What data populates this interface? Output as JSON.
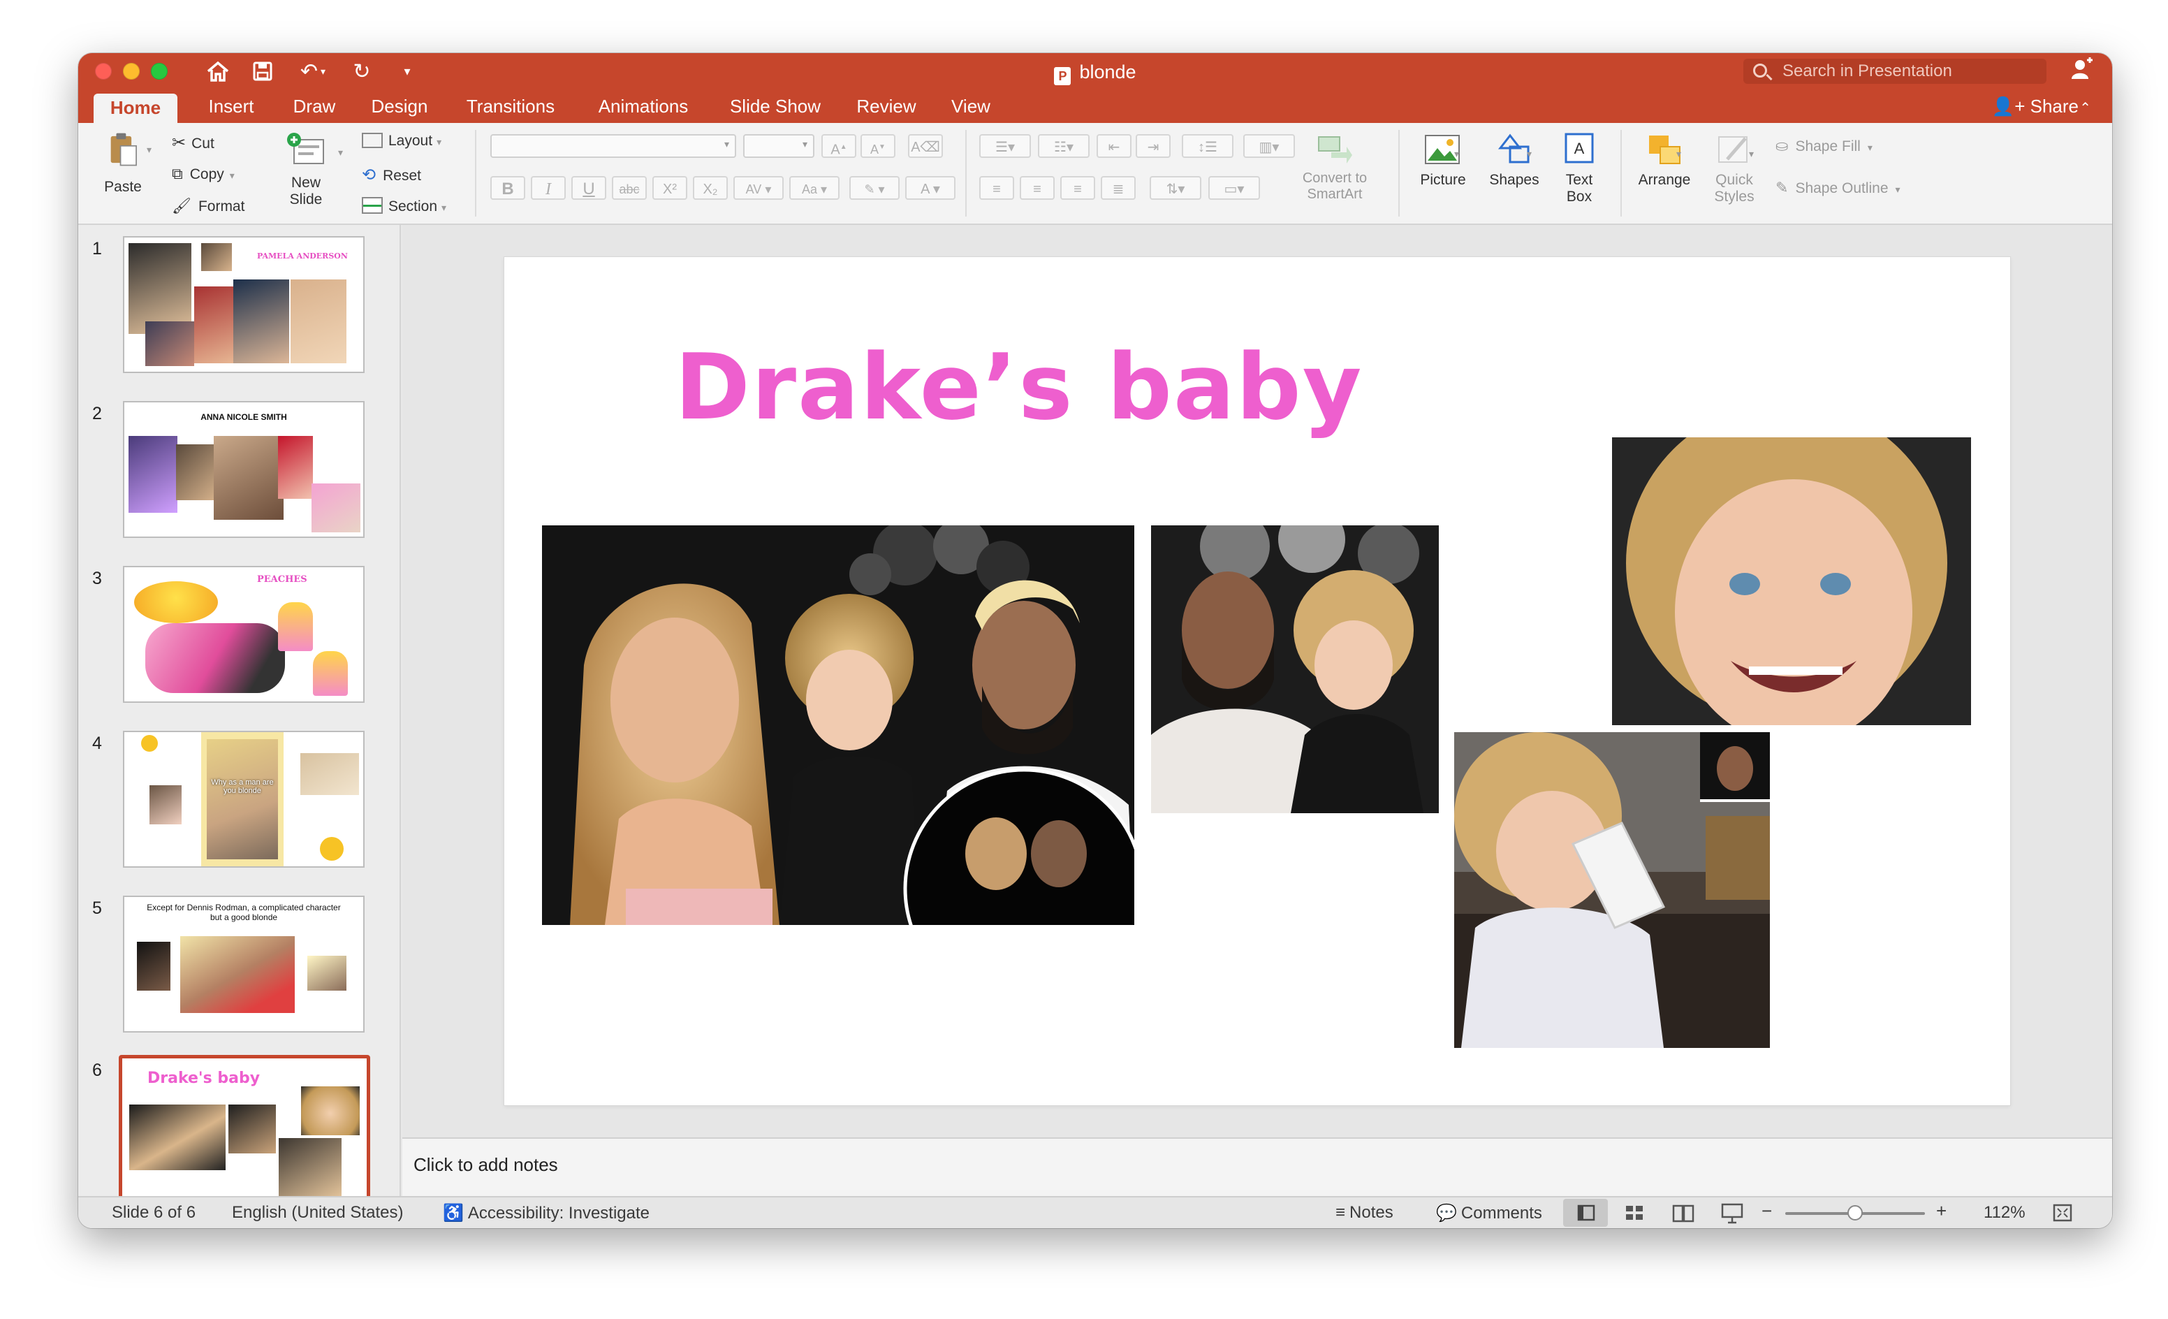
{
  "window": {
    "title": "blonde",
    "search_placeholder": "Search in Presentation"
  },
  "tabs": [
    {
      "label": "Home",
      "active": true
    },
    {
      "label": "Insert"
    },
    {
      "label": "Draw"
    },
    {
      "label": "Design"
    },
    {
      "label": "Transitions"
    },
    {
      "label": "Animations"
    },
    {
      "label": "Slide Show"
    },
    {
      "label": "Review"
    },
    {
      "label": "View"
    }
  ],
  "share_label": "Share",
  "ribbon": {
    "paste": "Paste",
    "cut": "Cut",
    "copy": "Copy",
    "format": "Format",
    "new_slide_line1": "New",
    "new_slide_line2": "Slide",
    "layout": "Layout",
    "reset": "Reset",
    "section": "Section",
    "convert_line1": "Convert to",
    "convert_line2": "SmartArt",
    "picture": "Picture",
    "shapes": "Shapes",
    "textbox_line1": "Text",
    "textbox_line2": "Box",
    "arrange": "Arrange",
    "quick_styles_line1": "Quick",
    "quick_styles_line2": "Styles",
    "shape_fill": "Shape Fill",
    "shape_outline": "Shape Outline"
  },
  "thumbnails": [
    {
      "number": "1",
      "title": "PAMELA ANDERSON"
    },
    {
      "number": "2",
      "title": "ANNA NICOLE SMITH"
    },
    {
      "number": "3",
      "title": "PEACHES"
    },
    {
      "number": "4",
      "title": "Why as a man are you blonde"
    },
    {
      "number": "5",
      "title": "Except for Dennis Rodman, a complicated character but a good blonde"
    },
    {
      "number": "6",
      "title": "Drake's baby",
      "selected": true
    }
  ],
  "slide": {
    "title": "Drake’s baby"
  },
  "notes_placeholder": "Click to add notes",
  "status": {
    "slide_counter": "Slide 6 of 6",
    "language": "English (United States)",
    "accessibility": "Accessibility: Investigate",
    "notes": "Notes",
    "comments": "Comments",
    "zoom": "112%",
    "zoom_fraction": 0.5
  },
  "colors": {
    "accent": "#c6462c",
    "title_pink": "#ee5fce"
  }
}
